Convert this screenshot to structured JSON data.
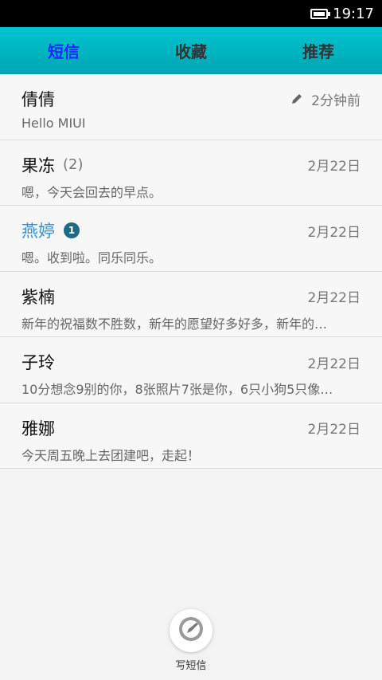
{
  "status_bar": {
    "time": "19:17"
  },
  "tabs": [
    {
      "label": "短信",
      "active": true
    },
    {
      "label": "收藏",
      "active": false
    },
    {
      "label": "推荐",
      "active": false
    }
  ],
  "conversations": [
    {
      "name": "倩倩",
      "count": "",
      "badge": "",
      "time": "2分钟前",
      "draft_icon": true,
      "preview": "Hello MIUI"
    },
    {
      "name": "果冻",
      "count": "(2)",
      "badge": "",
      "time": "2月22日",
      "draft_icon": false,
      "preview": "嗯，今天会回去的早点。"
    },
    {
      "name": "燕婷",
      "count": "",
      "badge": "1",
      "time": "2月22日",
      "draft_icon": false,
      "preview": "嗯。收到啦。同乐同乐。"
    },
    {
      "name": "紫楠",
      "count": "",
      "badge": "",
      "time": "2月22日",
      "draft_icon": false,
      "preview": "新年的祝福数不胜数，新年的愿望好多好多，新年的…"
    },
    {
      "name": "子玲",
      "count": "",
      "badge": "",
      "time": "2月22日",
      "draft_icon": false,
      "preview": "10分想念9别的你，8张照片7张是你，6只小狗5只像…"
    },
    {
      "name": "雅娜",
      "count": "",
      "badge": "",
      "time": "2月22日",
      "draft_icon": false,
      "preview": "今天周五晚上去团建吧，走起！"
    }
  ],
  "compose": {
    "label": "写短信"
  },
  "colors": {
    "tab_bar": "#00b5c1",
    "active_tab": "#1a2cff",
    "unread_name": "#3a8fc8",
    "badge": "#1d6a86"
  }
}
